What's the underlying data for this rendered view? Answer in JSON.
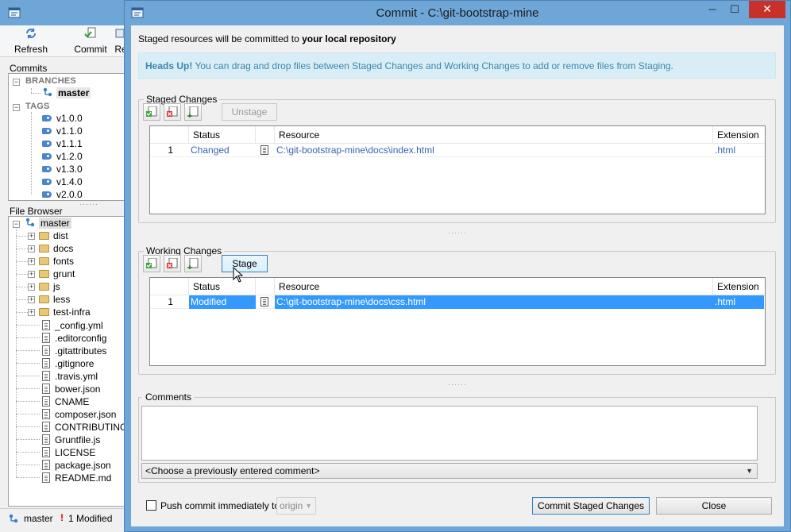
{
  "app": {
    "toolbar": {
      "refresh": "Refresh",
      "commit": "Commit",
      "rest": "Re"
    },
    "commits": {
      "title": "Commits",
      "branches_label": "BRANCHES",
      "current_branch": "master",
      "tags_label": "TAGS",
      "tags": [
        "v1.0.0",
        "v1.1.0",
        "v1.1.1",
        "v1.2.0",
        "v1.3.0",
        "v1.4.0",
        "v2.0.0"
      ]
    },
    "file_browser": {
      "title": "File Browser",
      "root": "master",
      "folders": [
        "dist",
        "docs",
        "fonts",
        "grunt",
        "js",
        "less",
        "test-infra"
      ],
      "files": [
        "_config.yml",
        ".editorconfig",
        ".gitattributes",
        ".gitignore",
        ".travis.yml",
        "bower.json",
        "CNAME",
        "composer.json",
        "CONTRIBUTING.m",
        "Gruntfile.js",
        "LICENSE",
        "package.json",
        "README.md"
      ]
    },
    "status": {
      "branch": "master",
      "modified": "1 Modified"
    }
  },
  "dialog": {
    "title": "Commit - C:\\git-bootstrap-mine",
    "window_controls": {
      "minimize": "─",
      "maximize": "☐",
      "close": "✕"
    },
    "info": {
      "prefix": "Staged resources will be committed to ",
      "target": "your local repository"
    },
    "alert": {
      "heading": "Heads Up!",
      "text": " You can drag and drop files between Staged Changes and Working Changes to add or remove files from Staging."
    },
    "staged": {
      "title": "Staged Changes",
      "button": "Unstage",
      "columns": [
        "Status",
        "Resource",
        "Extension"
      ],
      "rows": [
        {
          "num": "1",
          "status": "Changed",
          "resource": "C:\\git-bootstrap-mine\\docs\\index.html",
          "extension": ".html"
        }
      ]
    },
    "working": {
      "title": "Working Changes",
      "button": "Stage",
      "columns": [
        "Status",
        "Resource",
        "Extension"
      ],
      "rows": [
        {
          "num": "1",
          "status": "Modified",
          "resource": "C:\\git-bootstrap-mine\\docs\\css.html",
          "extension": ".html"
        }
      ]
    },
    "comments": {
      "title": "Comments",
      "value": "",
      "previous_placeholder": "<Choose a previously entered comment>"
    },
    "footer": {
      "push_label": "Push commit immediately to:",
      "push_checked": false,
      "remote": "origin",
      "commit_button": "Commit Staged Changes",
      "close_button": "Close"
    },
    "colors": {
      "accent": "#3399ff",
      "link": "#3a63b0",
      "alert_bg": "#d9edf7",
      "alert_text": "#3a87ad",
      "titlebar": "#6fa6d8",
      "close": "#c7312c"
    }
  }
}
